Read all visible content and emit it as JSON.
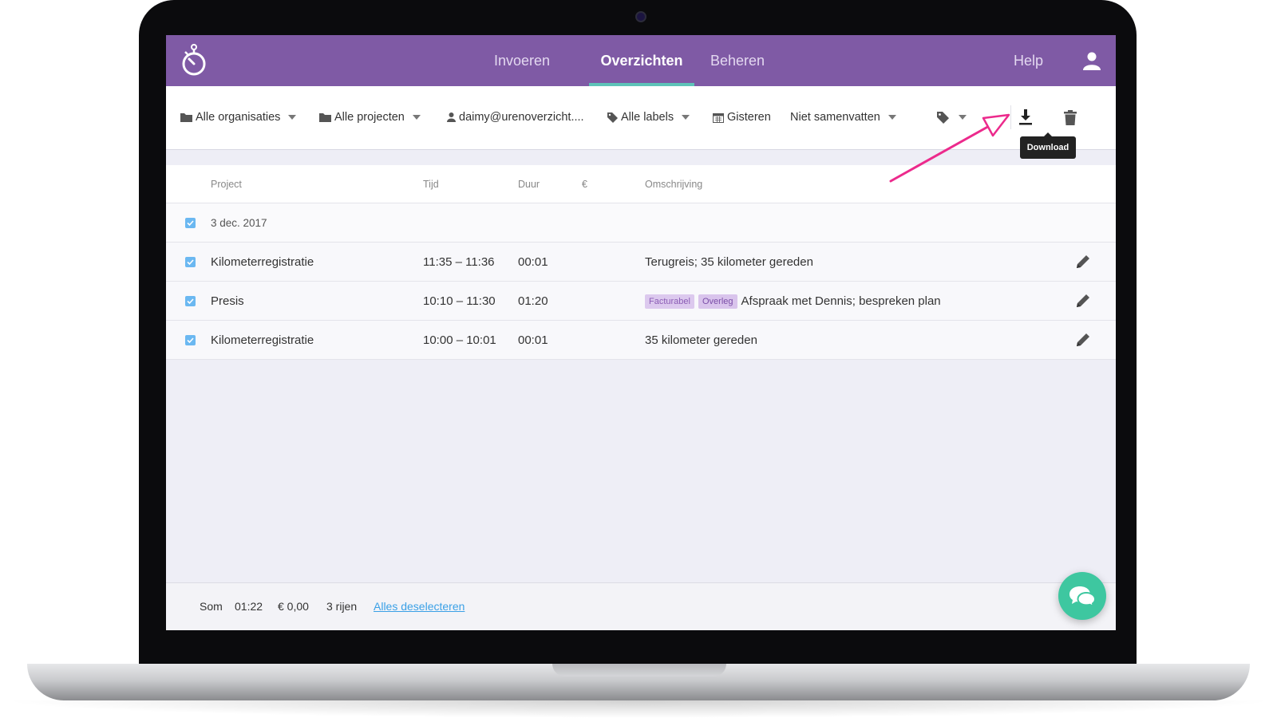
{
  "nav": {
    "tabs": [
      {
        "label": "Invoeren",
        "active": false
      },
      {
        "label": "Overzichten",
        "active": true
      },
      {
        "label": "Beheren",
        "active": false
      }
    ],
    "help": "Help",
    "accent_color": "#7f5aa5",
    "active_underline_color": "#5ec3b8",
    "icons": {
      "logo": "stopwatch-logo",
      "user": "user-icon"
    }
  },
  "filters": {
    "organisations": "Alle organisaties",
    "projects": "Alle projecten",
    "user": "daimy@urenoverzicht....",
    "labels": "Alle labels",
    "date": "Gisteren",
    "summary": "Niet samenvatten",
    "icons": {
      "folder": "folder-icon",
      "user": "user-icon",
      "tag": "tag-icon",
      "calendar": "calendar-icon",
      "caret": "caret-down-icon",
      "download": "download-icon",
      "delete": "trash-icon"
    }
  },
  "tooltip": {
    "download": "Download"
  },
  "table": {
    "headers": {
      "project": "Project",
      "time": "Tijd",
      "duration": "Duur",
      "amount": "€",
      "description": "Omschrijving"
    },
    "date_group": "3 dec. 2017",
    "rows": [
      {
        "project": "Kilometerregistratie",
        "time": "11:35 – 11:36",
        "duration": "00:01",
        "tags": [],
        "description": "Terugreis; 35 kilometer gereden",
        "checked": true
      },
      {
        "project": "Presis",
        "time": "10:10 – 11:30",
        "duration": "01:20",
        "tags": [
          "Facturabel",
          "Overleg"
        ],
        "description": "Afspraak met Dennis; bespreken plan",
        "checked": true
      },
      {
        "project": "Kilometerregistratie",
        "time": "10:00 – 10:01",
        "duration": "00:01",
        "tags": [],
        "description": "35 kilometer gereden",
        "checked": true
      }
    ]
  },
  "footer": {
    "sum_label": "Som",
    "sum_duration": "01:22",
    "sum_amount": "€ 0,00",
    "row_count": "3 rijen",
    "deselect_link": "Alles deselecteren"
  },
  "chat": {
    "icon": "chat-bubbles-icon",
    "color": "#3ec7a0"
  },
  "annotation": {
    "arrow_color": "#ec2a8c"
  }
}
